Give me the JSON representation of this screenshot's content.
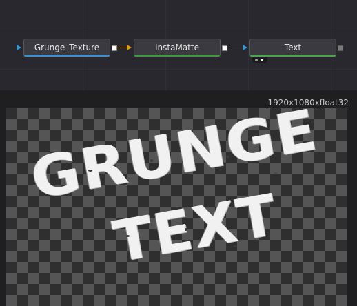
{
  "nodes": {
    "grunge_texture": {
      "label": "Grunge_Texture",
      "accent": "#3a8fd6"
    },
    "instamatte": {
      "label": "InstaMatte",
      "accent": "#3f9a3f"
    },
    "text": {
      "label": "Text",
      "accent": "#49a64a"
    }
  },
  "connections": {
    "main_color": "#d9d9d9",
    "mask_color": "#e3a21a"
  },
  "viewer": {
    "resolution": "1920x1080xfloat32",
    "line1": "GRUNGE",
    "line2": "TEXT"
  }
}
